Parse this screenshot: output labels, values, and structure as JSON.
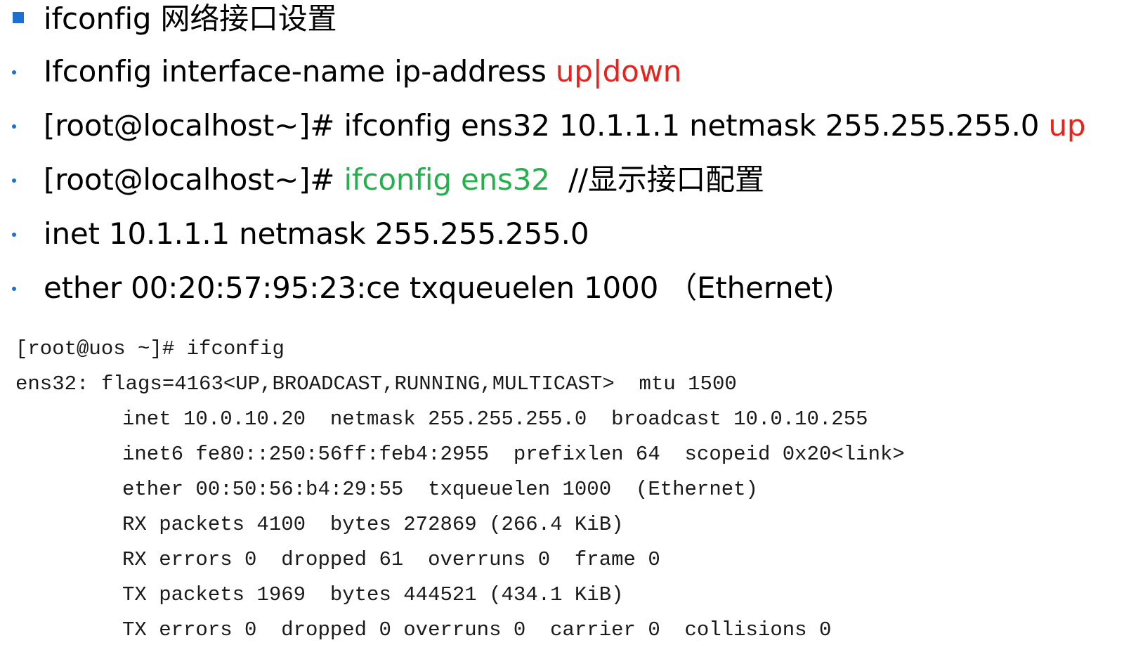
{
  "bullets": [
    {
      "marker": "square",
      "segments": [
        {
          "text": "ifconfig 网络接口设置",
          "color": "default"
        }
      ]
    },
    {
      "marker": "dot",
      "segments": [
        {
          "text": "Ifconfig interface-name ip-address ",
          "color": "default"
        },
        {
          "text": "up|down",
          "color": "red"
        }
      ]
    },
    {
      "marker": "dot",
      "segments": [
        {
          "text": "[root@localhost~]# ifconfig ens32 10.1.1.1 netmask 255.255.255.0 ",
          "color": "default"
        },
        {
          "text": "up",
          "color": "red"
        }
      ]
    },
    {
      "marker": "dot",
      "segments": [
        {
          "text": "[root@localhost~]# ",
          "color": "default"
        },
        {
          "text": "ifconfig ens32",
          "color": "green"
        },
        {
          "text": "  //显示接口配置",
          "color": "default"
        }
      ]
    },
    {
      "marker": "dot",
      "segments": [
        {
          "text": "inet 10.1.1.1 netmask 255.255.255.0",
          "color": "default"
        }
      ]
    },
    {
      "marker": "dot",
      "segments": [
        {
          "text": "ether 00:20:57:95:23:ce txqueuelen 1000 （Ethernet)",
          "color": "default"
        }
      ]
    }
  ],
  "colors": {
    "accent_blue": "#1d6fd0",
    "red": "#e8231c",
    "green": "#22b14c",
    "terminal_text": "#1a1a1a"
  },
  "terminal": {
    "lines": [
      {
        "text": "[root@uos ~]# ifconfig",
        "indent": false
      },
      {
        "text": "ens32: flags=4163<UP,BROADCAST,RUNNING,MULTICAST>  mtu 1500",
        "indent": false
      },
      {
        "text": "inet 10.0.10.20  netmask 255.255.255.0  broadcast 10.0.10.255",
        "indent": true
      },
      {
        "text": "inet6 fe80::250:56ff:feb4:2955  prefixlen 64  scopeid 0x20<link>",
        "indent": true
      },
      {
        "text": "ether 00:50:56:b4:29:55  txqueuelen 1000  (Ethernet)",
        "indent": true
      },
      {
        "text": "RX packets 4100  bytes 272869 (266.4 KiB)",
        "indent": true
      },
      {
        "text": "RX errors 0  dropped 61  overruns 0  frame 0",
        "indent": true
      },
      {
        "text": "TX packets 1969  bytes 444521 (434.1 KiB)",
        "indent": true
      },
      {
        "text": "TX errors 0  dropped 0 overruns 0  carrier 0  collisions 0",
        "indent": true
      }
    ]
  }
}
